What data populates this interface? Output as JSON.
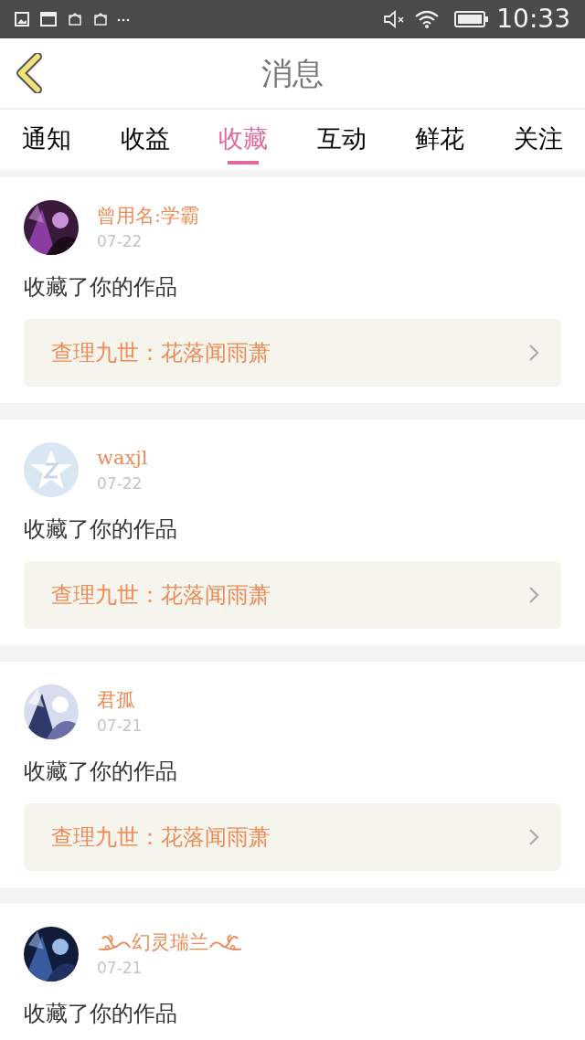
{
  "status_bar": {
    "time": "10:33"
  },
  "header": {
    "title": "消息"
  },
  "tabs": [
    {
      "label": "通知",
      "selected": false
    },
    {
      "label": "收益",
      "selected": false
    },
    {
      "label": "收藏",
      "selected": true
    },
    {
      "label": "互动",
      "selected": false
    },
    {
      "label": "鲜花",
      "selected": false
    },
    {
      "label": "关注",
      "selected": false
    }
  ],
  "messages": [
    {
      "name": "曾用名:学霸",
      "decorated": false,
      "date": "07-22",
      "action": "收藏了你的作品",
      "work": "查理九世：花落闻雨萧"
    },
    {
      "avatar": {
        "kind": "default"
      },
      "name": "waxjl",
      "decorated": false,
      "date": "07-22",
      "action": "收藏了你的作品",
      "work": "查理九世：花落闻雨萧"
    },
    {
      "name": "君孤",
      "decorated": false,
      "date": "07-21",
      "action": "收藏了你的作品",
      "work": "查理九世：花落闻雨萧"
    },
    {
      "name": "幻灵瑞兰",
      "decorated": true,
      "date": "07-21",
      "action": "收藏了你的作品"
    }
  ]
}
